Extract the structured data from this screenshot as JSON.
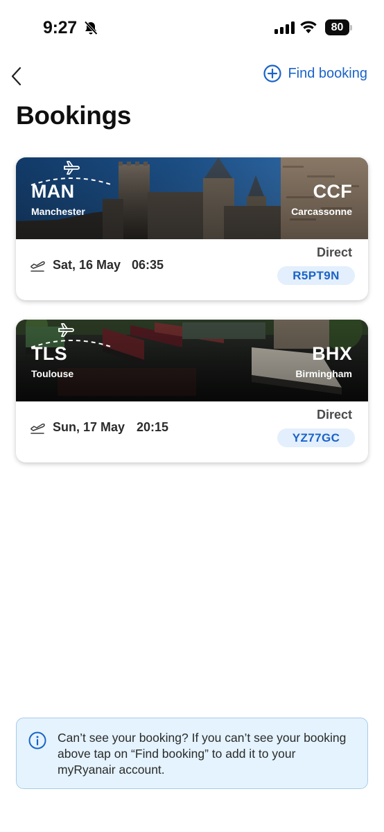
{
  "status_bar": {
    "time": "9:27",
    "battery": "80"
  },
  "header": {
    "back_icon": "chevron-left-icon",
    "find_booking_label": "Find booking",
    "find_booking_icon": "plus-circle-icon",
    "title": "Bookings"
  },
  "bookings": [
    {
      "origin_code": "MAN",
      "origin_city": "Manchester",
      "destination_code": "CCF",
      "destination_city": "Carcassonne",
      "date": "Sat, 16 May",
      "time": "06:35",
      "type": "Direct",
      "reference": "R5PT9N"
    },
    {
      "origin_code": "TLS",
      "origin_city": "Toulouse",
      "destination_code": "BHX",
      "destination_city": "Birmingham",
      "date": "Sun, 17 May",
      "time": "20:15",
      "type": "Direct",
      "reference": "YZ77GC"
    }
  ],
  "info_banner": {
    "text": "Can’t see your booking? If you can’t see your booking above tap on “Find booking” to add it to your myRyanair account."
  },
  "colors": {
    "accent": "#1a63c8",
    "reference_bg": "#e3effc",
    "banner_bg": "#e4f3fd",
    "banner_border": "#a9cbe8"
  }
}
